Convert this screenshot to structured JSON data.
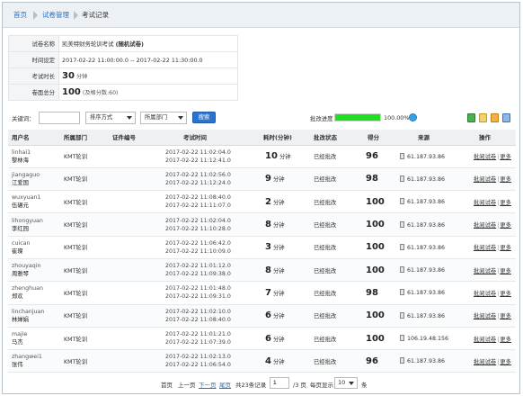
{
  "breadcrumb": {
    "home": "首页",
    "manage": "试卷管理",
    "current": "考试记录"
  },
  "info": {
    "name_label": "试卷名称",
    "name_value": "凯美特财务轮训考试",
    "name_tag": "(随机试卷)",
    "time_label": "时间设定",
    "time_value": "2017-02-22 11:00:00.0 -- 2017-02-22 11:30:00.0",
    "duration_label": "考试时长",
    "duration_value": "30",
    "duration_unit": "分钟",
    "total_label": "卷面总分",
    "total_value": "100",
    "pass_note": "(及格分数:60)"
  },
  "filter": {
    "keyword_label": "关键词：",
    "keyword_value": "",
    "sort_label": "排序方式",
    "dept_label": "所属部门",
    "search_label": "搜索",
    "progress_label": "批改进度",
    "progress_percent": "100.00%",
    "progress_fraction": 1.0
  },
  "columns": [
    "用户名",
    "所属部门",
    "证件编号",
    "考试时间",
    "耗时(分钟)",
    "批改状态",
    "得分",
    "来源",
    "操作"
  ],
  "rows": [
    {
      "user": "linhai1",
      "name": "黎林海",
      "dept": "KMT轮训",
      "cert": "",
      "start": "2017-02-22 11:02:04.0",
      "end": "2017-02-22 11:12:41.0",
      "dur": "10",
      "unit": "分钟",
      "status": "已经批改",
      "score": "96",
      "ip": "61.187.93.86",
      "op1": "批阅试卷",
      "op2": "更多"
    },
    {
      "user": "jiangaguo",
      "name": "江爱国",
      "dept": "KMT轮训",
      "cert": "",
      "start": "2017-02-22 11:02:56.0",
      "end": "2017-02-22 11:12:24.0",
      "dur": "9",
      "unit": "分钟",
      "status": "已经批改",
      "score": "98",
      "ip": "61.187.93.86",
      "op1": "批阅试卷",
      "op2": "更多"
    },
    {
      "user": "wuxyuan1",
      "name": "伍碾元",
      "dept": "KMT轮训",
      "cert": "",
      "start": "2017-02-22 11:08:40.0",
      "end": "2017-02-22 11:11:07.0",
      "dur": "2",
      "unit": "分钟",
      "status": "已经批改",
      "score": "100",
      "ip": "61.187.93.86",
      "op1": "批阅试卷",
      "op2": "更多"
    },
    {
      "user": "lihongyuan",
      "name": "李红园",
      "dept": "KMT轮训",
      "cert": "",
      "start": "2017-02-22 11:02:04.0",
      "end": "2017-02-22 11:10:28.0",
      "dur": "8",
      "unit": "分钟",
      "status": "已经批改",
      "score": "100",
      "ip": "61.187.93.86",
      "op1": "批阅试卷",
      "op2": "更多"
    },
    {
      "user": "cuican",
      "name": "崔璨",
      "dept": "KMT轮训",
      "cert": "",
      "start": "2017-02-22 11:06:42.0",
      "end": "2017-02-22 11:10:09.0",
      "dur": "3",
      "unit": "分钟",
      "status": "已经批改",
      "score": "100",
      "ip": "61.187.93.86",
      "op1": "批阅试卷",
      "op2": "更多"
    },
    {
      "user": "zhouyaqin",
      "name": "周雅琴",
      "dept": "KMT轮训",
      "cert": "",
      "start": "2017-02-22 11:01:12.0",
      "end": "2017-02-22 11:09:38.0",
      "dur": "8",
      "unit": "分钟",
      "status": "已经批改",
      "score": "100",
      "ip": "61.187.93.86",
      "op1": "批阅试卷",
      "op2": "更多"
    },
    {
      "user": "zhenghuan",
      "name": "郑欢",
      "dept": "KMT轮训",
      "cert": "",
      "start": "2017-02-22 11:01:48.0",
      "end": "2017-02-22 11:09:31.0",
      "dur": "7",
      "unit": "分钟",
      "status": "已经批改",
      "score": "98",
      "ip": "61.187.93.86",
      "op1": "批阅试卷",
      "op2": "更多"
    },
    {
      "user": "linchanjuan",
      "name": "林婵娟",
      "dept": "KMT轮训",
      "cert": "",
      "start": "2017-02-22 11:02:10.0",
      "end": "2017-02-22 11:08:40.0",
      "dur": "6",
      "unit": "分钟",
      "status": "已经批改",
      "score": "100",
      "ip": "61.187.93.86",
      "op1": "批阅试卷",
      "op2": "更多"
    },
    {
      "user": "majie",
      "name": "马杰",
      "dept": "KMT轮训",
      "cert": "",
      "start": "2017-02-22 11:01:21.0",
      "end": "2017-02-22 11:07:39.0",
      "dur": "6",
      "unit": "分钟",
      "status": "已经批改",
      "score": "100",
      "ip": "106.19.48.156",
      "op1": "批阅试卷",
      "op2": "更多"
    },
    {
      "user": "zhangwei1",
      "name": "张伟",
      "dept": "KMT轮训",
      "cert": "",
      "start": "2017-02-22 11:02:13.0",
      "end": "2017-02-22 11:06:54.0",
      "dur": "4",
      "unit": "分钟",
      "status": "已经批改",
      "score": "96",
      "ip": "61.187.93.86",
      "op1": "批阅试卷",
      "op2": "更多"
    }
  ],
  "pager": {
    "first": "首页",
    "prev": "上一页",
    "next": "下一页",
    "last": "尾页",
    "total": "共23条记录",
    "page": "1",
    "pages": "/3 页",
    "per_label": "每页显示",
    "per_value": "10",
    "per_unit": "条"
  },
  "colors": {
    "accent": "#2a73d0",
    "progress": "#1ee01e",
    "link": "#2a6fc4"
  }
}
